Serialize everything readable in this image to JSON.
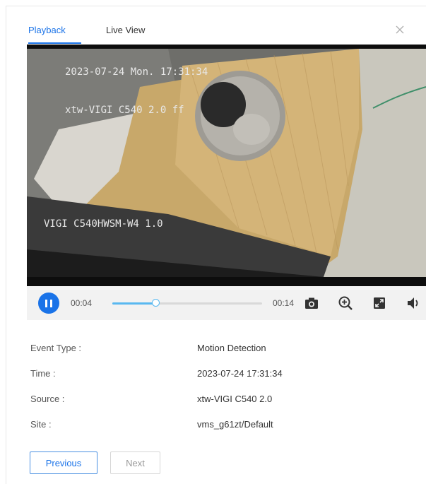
{
  "tabs": [
    {
      "label": "Playback",
      "active": true
    },
    {
      "label": "Live View",
      "active": false
    }
  ],
  "video": {
    "overlay_datetime": "2023-07-24 Mon. 17:31:34",
    "overlay_device": "xtw-VIGI C540 2.0 ff",
    "overlay_model": "VIGI C540HWSM-W4 1.0"
  },
  "player": {
    "state_icon": "pause-icon",
    "current_time": "00:04",
    "total_time": "00:14",
    "progress_fraction": 0.29,
    "accent_color": "#1a73e8",
    "progress_color": "#59b8f0",
    "icons": [
      "snapshot-icon",
      "zoom-in-icon",
      "fullscreen-icon",
      "volume-icon"
    ]
  },
  "details": [
    {
      "label": "Event Type :",
      "value": "Motion Detection"
    },
    {
      "label": "Time :",
      "value": "2023-07-24 17:31:34"
    },
    {
      "label": "Source :",
      "value": "xtw-VIGI C540 2.0"
    },
    {
      "label": "Site :",
      "value": "vms_g61zt/Default"
    }
  ],
  "buttons": {
    "previous": "Previous",
    "next": "Next"
  }
}
